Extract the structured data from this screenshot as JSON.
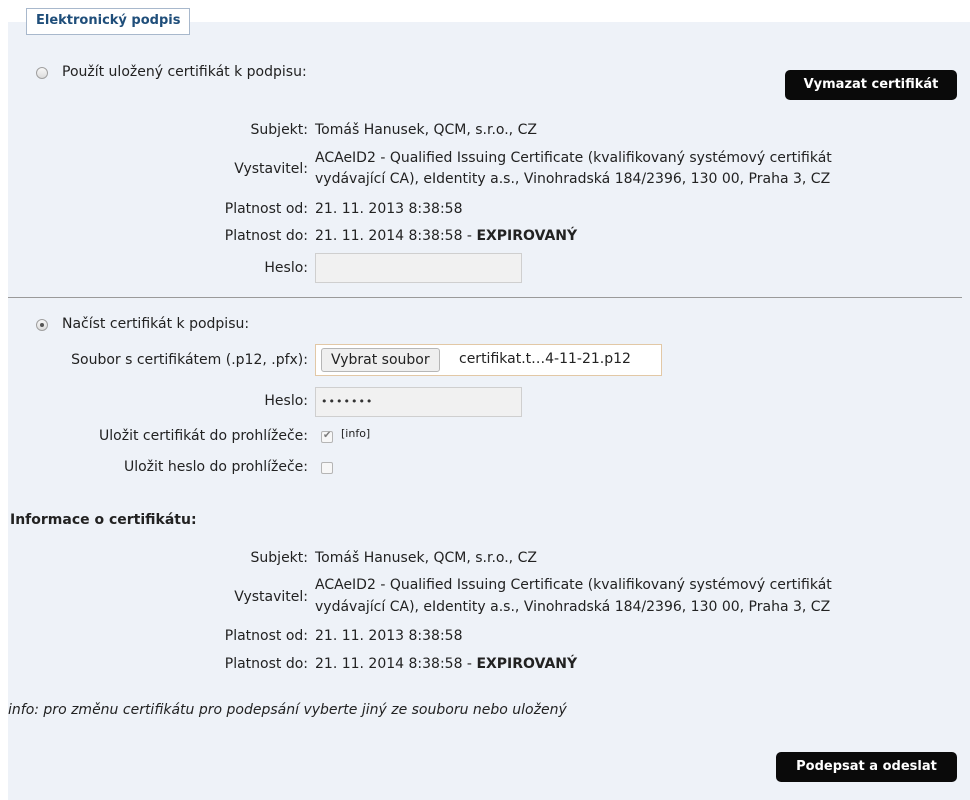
{
  "tab_title": "Elektronický podpis",
  "stored": {
    "radio_label": "Použít uložený certifikát k podpisu:",
    "delete_button": "Vymazat certifikát",
    "subject_label": "Subjekt:",
    "subject_value": "Tomáš Hanusek, QCM, s.r.o., CZ",
    "issuer_label": "Vystavitel:",
    "issuer_line1": "ACAeID2 - Qualified Issuing Certificate (kvalifikovaný systémový certifikát",
    "issuer_line2": "vydávající CA), eIdentity a.s., Vinohradská 184/2396, 130 00, Praha 3, CZ",
    "valid_from_label": "Platnost od:",
    "valid_from_value": "21. 11. 2013 8:38:58",
    "valid_to_label": "Platnost do:",
    "valid_to_value": "21. 11. 2014 8:38:58 - ",
    "expired": "EXPIROVANÝ",
    "password_label": "Heslo:",
    "password_value": ""
  },
  "load": {
    "radio_label": "Načíst certifikát k podpisu:",
    "file_label": "Soubor s certifikátem (.p12, .pfx):",
    "file_button": "Vybrat soubor",
    "file_name": "certifikat.t…4-11-21.p12",
    "password_label": "Heslo:",
    "password_value": "•••••••",
    "save_cert_label": "Uložit certifikát do prohlížeče:",
    "save_cert_checked": true,
    "info_link": "[info]",
    "save_pw_label": "Uložit heslo do prohlížeče:",
    "save_pw_checked": false
  },
  "info": {
    "heading": "Informace o certifikátu:",
    "subject_label": "Subjekt:",
    "subject_value": "Tomáš Hanusek, QCM, s.r.o., CZ",
    "issuer_label": "Vystavitel:",
    "issuer_line1": "ACAeID2 - Qualified Issuing Certificate (kvalifikovaný systémový certifikát",
    "issuer_line2": "vydávající CA), eIdentity a.s., Vinohradská 184/2396, 130 00, Praha 3, CZ",
    "valid_from_label": "Platnost od:",
    "valid_from_value": "21. 11. 2013 8:38:58",
    "valid_to_label": "Platnost do:",
    "valid_to_value": "21. 11. 2014 8:38:58 - ",
    "expired": "EXPIROVANÝ"
  },
  "note": "info: pro změnu certifikátu pro podepsání vyberte jiný ze souboru nebo uložený",
  "submit_button": "Podepsat a odeslat"
}
